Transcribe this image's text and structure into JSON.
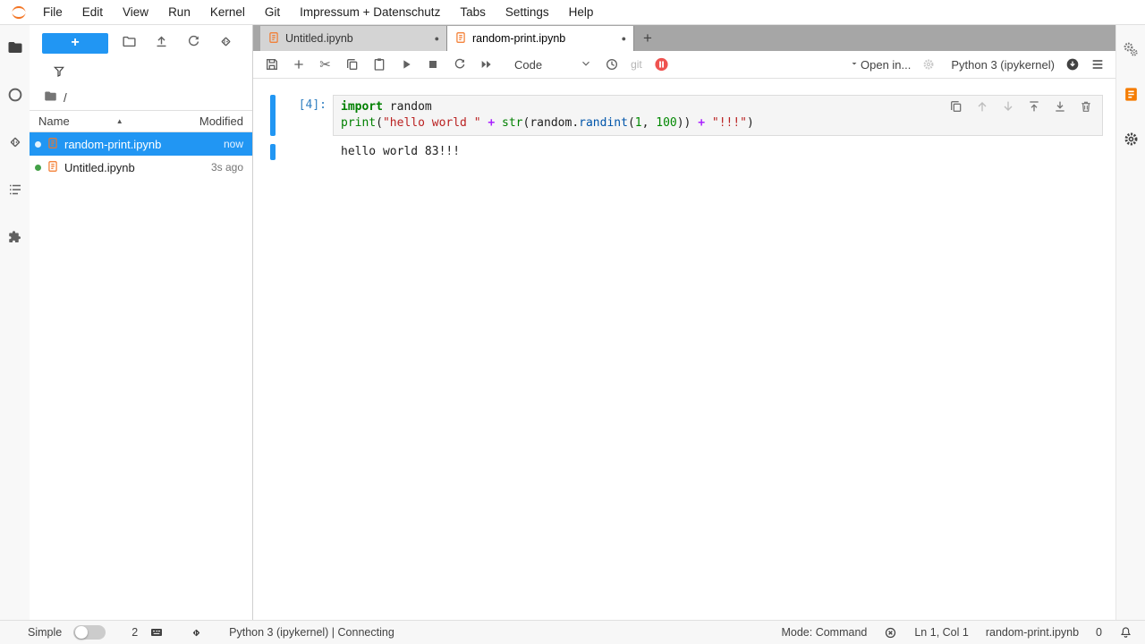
{
  "menubar": {
    "items": [
      "File",
      "Edit",
      "View",
      "Run",
      "Kernel",
      "Git",
      "Impressum + Datenschutz",
      "Tabs",
      "Settings",
      "Help"
    ]
  },
  "filebrowser": {
    "new_launcher": "+",
    "root": "/",
    "col_name": "Name",
    "col_modified": "Modified",
    "sort_indicator": "▲",
    "files": [
      {
        "name": "random-print.ipynb",
        "modified": "now",
        "dot_color": "#e3f2fd"
      },
      {
        "name": "Untitled.ipynb",
        "modified": "3s ago",
        "dot_color": "#43a047"
      }
    ]
  },
  "tabbar": {
    "tabs": [
      {
        "label": "Untitled.ipynb"
      },
      {
        "label": "random-print.ipynb"
      }
    ],
    "dirty_indicator": "●",
    "new_tab": "+"
  },
  "toolbar": {
    "cell_type": "Code",
    "git_label": "git",
    "open_in": "Open in...",
    "kernel_name": "Python 3 (ipykernel)"
  },
  "cell": {
    "prompt": "[4]:",
    "code_lines": [
      [
        {
          "t": "import",
          "c": "kw"
        },
        {
          "t": " random",
          "c": "pl"
        }
      ],
      [
        {
          "t": "print",
          "c": "bi"
        },
        {
          "t": "(",
          "c": "pl"
        },
        {
          "t": "\"hello world \"",
          "c": "str"
        },
        {
          "t": " ",
          "c": "pl"
        },
        {
          "t": "+",
          "c": "op"
        },
        {
          "t": " ",
          "c": "pl"
        },
        {
          "t": "str",
          "c": "bi"
        },
        {
          "t": "(",
          "c": "pl"
        },
        {
          "t": "random",
          "c": "pl"
        },
        {
          "t": ".",
          "c": "pl"
        },
        {
          "t": "randint",
          "c": "prop"
        },
        {
          "t": "(",
          "c": "pl"
        },
        {
          "t": "1",
          "c": "num"
        },
        {
          "t": ", ",
          "c": "pl"
        },
        {
          "t": "100",
          "c": "num"
        },
        {
          "t": "))",
          "c": "pl"
        },
        {
          "t": " ",
          "c": "pl"
        },
        {
          "t": "+",
          "c": "op"
        },
        {
          "t": " ",
          "c": "pl"
        },
        {
          "t": "\"!!!\"",
          "c": "str"
        },
        {
          "t": ")",
          "c": "pl"
        }
      ]
    ],
    "output": "hello world 83!!!"
  },
  "statusbar": {
    "simple": "Simple",
    "terminals": "2",
    "kernel": "Python 3 (ipykernel) | Connecting",
    "mode": "Mode: Command",
    "cursor": "Ln 1, Col 1",
    "file": "random-print.ipynb",
    "notifications": "0"
  },
  "colors": {
    "accent": "#2196f3",
    "brand_orange": "#f37626",
    "selection_bg": "#2196f3"
  }
}
